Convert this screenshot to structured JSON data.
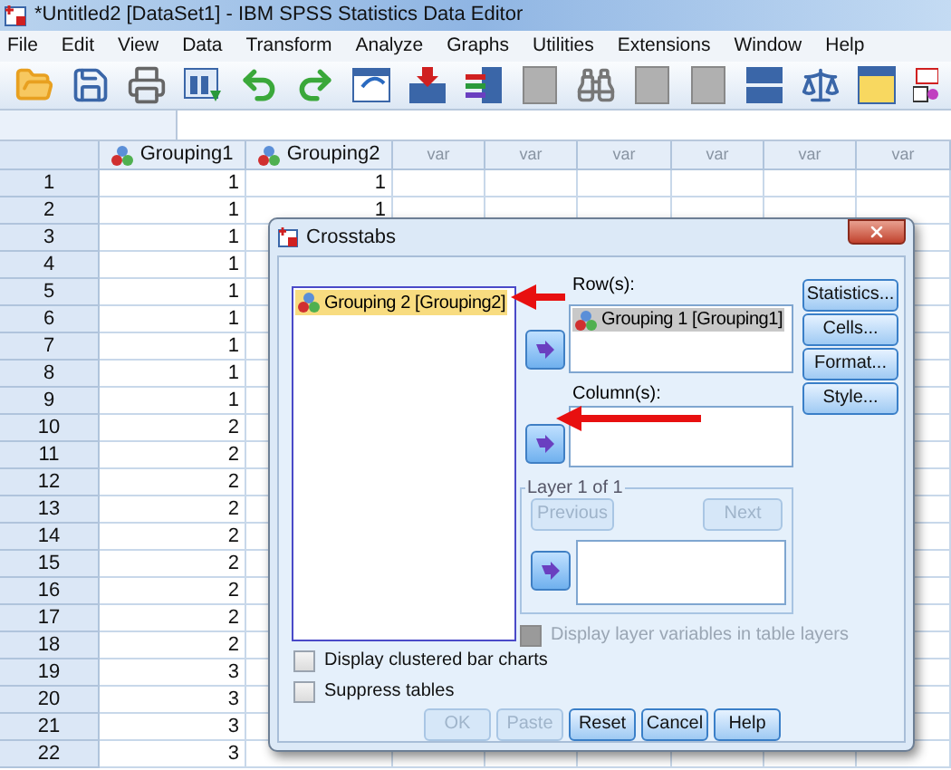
{
  "window": {
    "title": "*Untitled2 [DataSet1] - IBM SPSS Statistics Data Editor"
  },
  "menu": [
    "File",
    "Edit",
    "View",
    "Data",
    "Transform",
    "Analyze",
    "Graphs",
    "Utilities",
    "Extensions",
    "Window",
    "Help"
  ],
  "grid": {
    "columns": [
      {
        "label": "Grouping1",
        "kind": "variable"
      },
      {
        "label": "Grouping2",
        "kind": "variable"
      },
      {
        "label": "var",
        "kind": "empty"
      },
      {
        "label": "var",
        "kind": "empty"
      },
      {
        "label": "var",
        "kind": "empty"
      },
      {
        "label": "var",
        "kind": "empty"
      },
      {
        "label": "var",
        "kind": "empty"
      },
      {
        "label": "var",
        "kind": "empty"
      }
    ],
    "rows": [
      {
        "number": "1",
        "cells": [
          "1",
          "1"
        ]
      },
      {
        "number": "2",
        "cells": [
          "1",
          "1"
        ]
      },
      {
        "number": "3",
        "cells": [
          "1"
        ]
      },
      {
        "number": "4",
        "cells": [
          "1"
        ]
      },
      {
        "number": "5",
        "cells": [
          "1"
        ]
      },
      {
        "number": "6",
        "cells": [
          "1"
        ]
      },
      {
        "number": "7",
        "cells": [
          "1"
        ]
      },
      {
        "number": "8",
        "cells": [
          "1"
        ]
      },
      {
        "number": "9",
        "cells": [
          "1"
        ]
      },
      {
        "number": "10",
        "cells": [
          "2"
        ]
      },
      {
        "number": "11",
        "cells": [
          "2"
        ]
      },
      {
        "number": "12",
        "cells": [
          "2"
        ]
      },
      {
        "number": "13",
        "cells": [
          "2"
        ]
      },
      {
        "number": "14",
        "cells": [
          "2"
        ]
      },
      {
        "number": "15",
        "cells": [
          "2"
        ]
      },
      {
        "number": "16",
        "cells": [
          "2"
        ]
      },
      {
        "number": "17",
        "cells": [
          "2"
        ]
      },
      {
        "number": "18",
        "cells": [
          "2"
        ]
      },
      {
        "number": "19",
        "cells": [
          "3"
        ]
      },
      {
        "number": "20",
        "cells": [
          "3"
        ]
      },
      {
        "number": "21",
        "cells": [
          "3"
        ]
      },
      {
        "number": "22",
        "cells": [
          "3"
        ]
      }
    ]
  },
  "dialog": {
    "title": "Crosstabs",
    "source_list": [
      {
        "label": "Grouping 2 [Grouping2]",
        "selected": true
      }
    ],
    "rows_label": "Row(s):",
    "rows_list": [
      {
        "label": "Grouping 1 [Grouping1]",
        "selected": true
      }
    ],
    "columns_label": "Column(s):",
    "side_buttons": [
      {
        "label": "Statistics...",
        "disabled": false
      },
      {
        "label": "Cells...",
        "disabled": false
      },
      {
        "label": "Format...",
        "disabled": false
      },
      {
        "label": "Style...",
        "disabled": false
      }
    ],
    "layer": {
      "title": "Layer 1 of 1",
      "previous": {
        "label": "Previous",
        "disabled": true
      },
      "next": {
        "label": "Next",
        "disabled": true
      }
    },
    "layer_option": {
      "label": "Display layer variables in table layers",
      "checked": false,
      "disabled": true
    },
    "options": [
      {
        "label": "Display clustered bar charts",
        "checked": false,
        "disabled": false
      },
      {
        "label": "Suppress tables",
        "checked": false,
        "disabled": false
      }
    ],
    "buttons": [
      {
        "label": "OK",
        "disabled": true
      },
      {
        "label": "Paste",
        "disabled": true
      },
      {
        "label": "Reset",
        "disabled": false
      },
      {
        "label": "Cancel",
        "disabled": false
      },
      {
        "label": "Help",
        "disabled": false
      }
    ]
  }
}
